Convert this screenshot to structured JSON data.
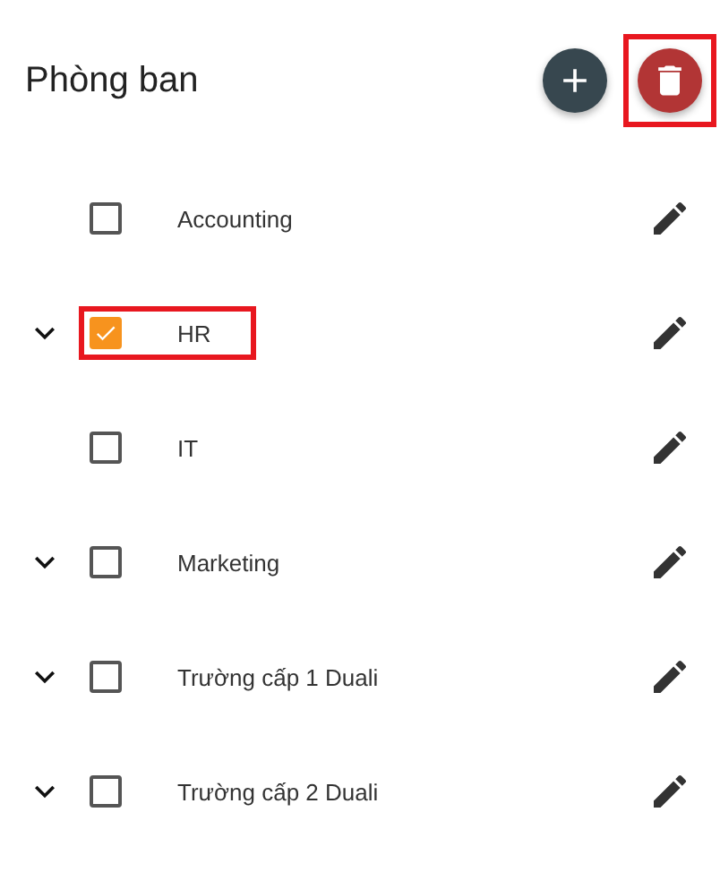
{
  "header": {
    "title": "Phòng ban",
    "add_button": {
      "highlighted": false
    },
    "delete_button": {
      "highlighted": true
    }
  },
  "departments": [
    {
      "label": "Accounting",
      "expandable": false,
      "checked": false,
      "highlighted": false
    },
    {
      "label": "HR",
      "expandable": true,
      "checked": true,
      "highlighted": true
    },
    {
      "label": "IT",
      "expandable": false,
      "checked": false,
      "highlighted": false
    },
    {
      "label": "Marketing",
      "expandable": true,
      "checked": false,
      "highlighted": false
    },
    {
      "label": "Trường cấp 1 Duali",
      "expandable": true,
      "checked": false,
      "highlighted": false
    },
    {
      "label": "Trường cấp 2 Duali",
      "expandable": true,
      "checked": false,
      "highlighted": false
    }
  ]
}
